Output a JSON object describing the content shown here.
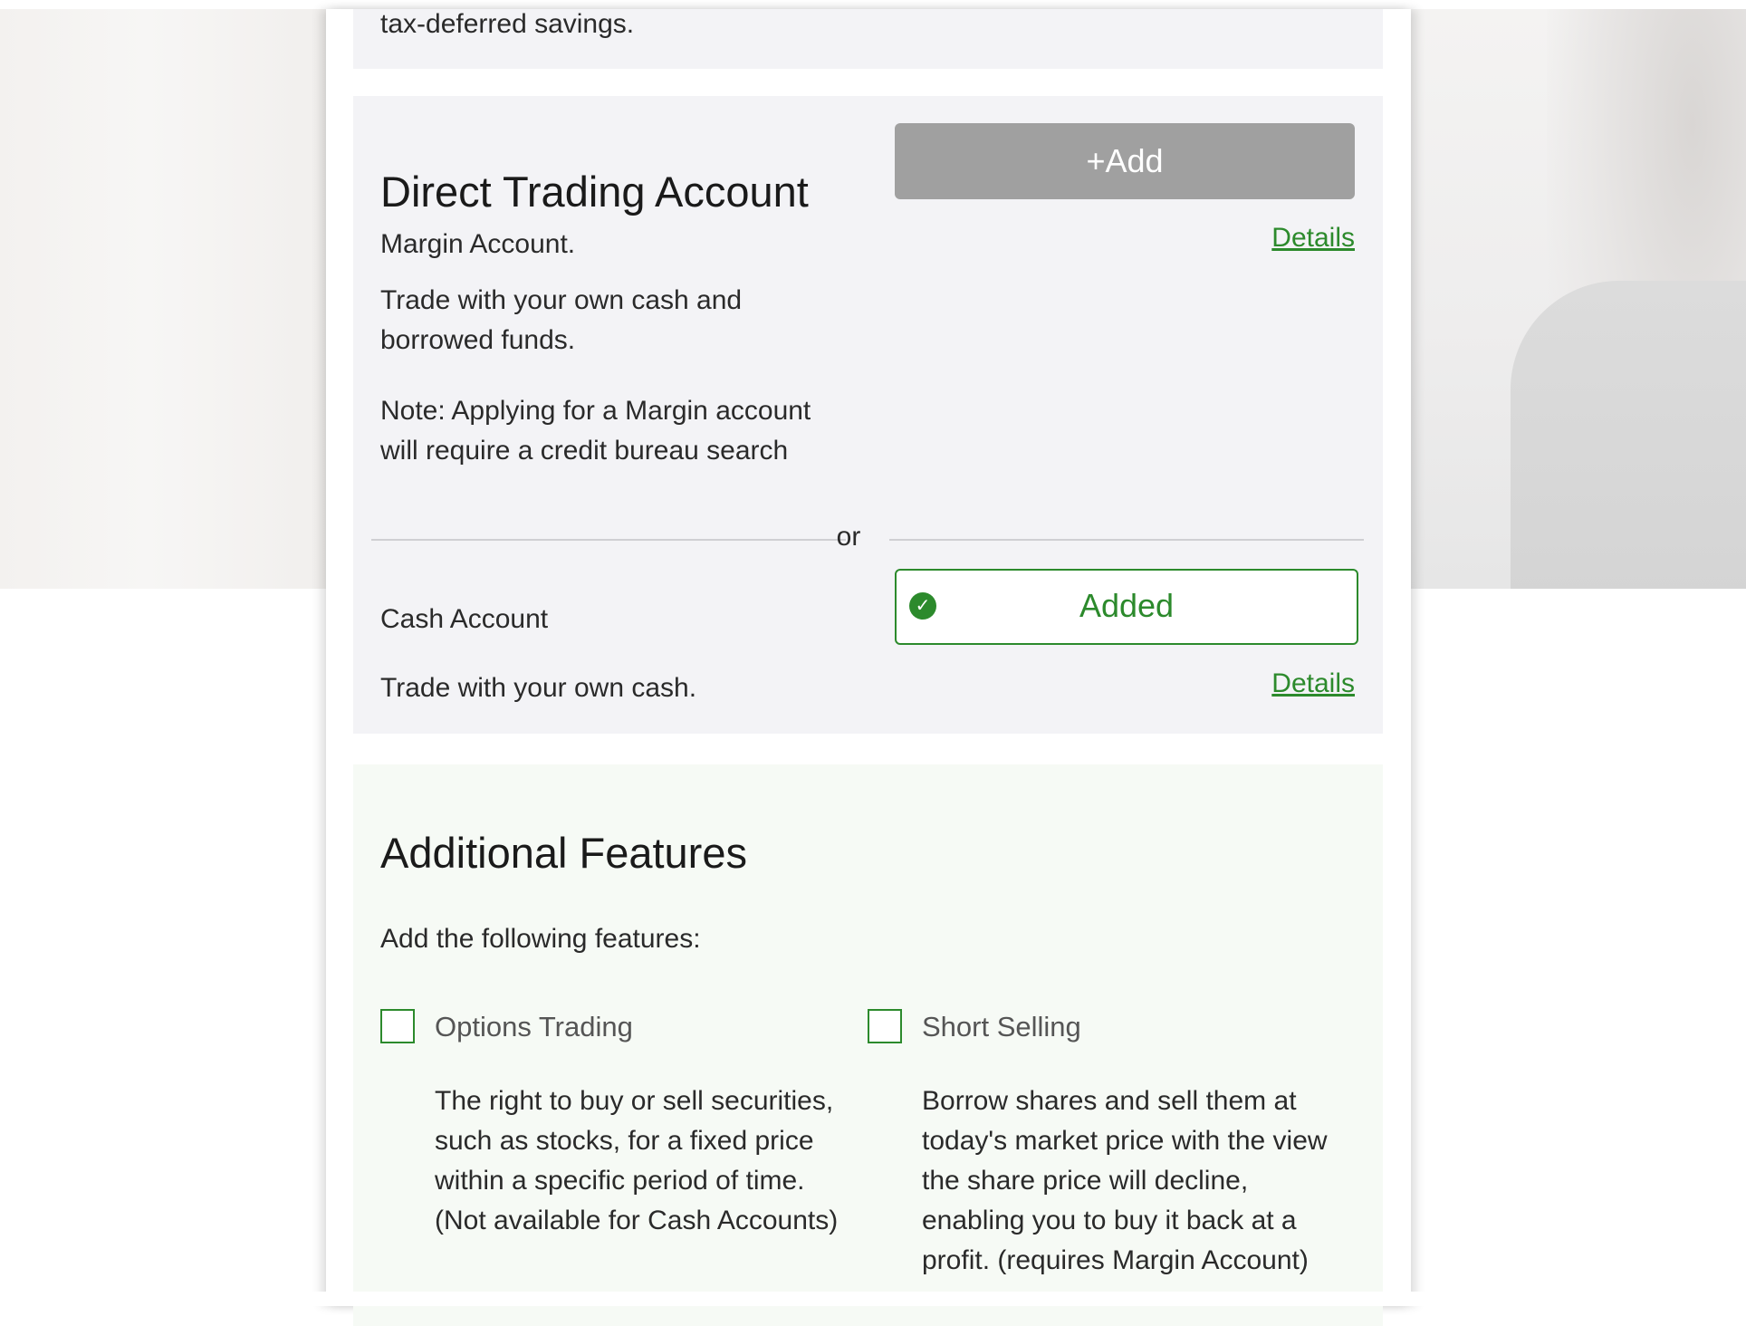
{
  "previous_card": {
    "text": "tax-deferred savings."
  },
  "direct_trading": {
    "title": "Direct Trading Account",
    "add_label": "+Add",
    "margin_details_label": "Details",
    "margin_title": "Margin Account.",
    "margin_desc_line1": "Trade with your own cash and",
    "margin_desc_line2": "borrowed funds.",
    "margin_note_line1": "Note: Applying for a Margin account",
    "margin_note_line2": "will require a credit bureau search",
    "or_label": "or",
    "cash_title": "Cash Account",
    "added_label": "Added",
    "cash_desc": "Trade with your own cash.",
    "cash_details_label": "Details"
  },
  "additional_features": {
    "title": "Additional Features",
    "intro": "Add the following features:",
    "options": {
      "label": "Options Trading",
      "checked": false,
      "desc": [
        "The right to buy or sell securities,",
        "such as stocks, for a fixed price",
        "within a specific period of time.",
        "(Not available for Cash Accounts)"
      ]
    },
    "short_selling": {
      "label": "Short Selling",
      "checked": false,
      "desc": [
        "Borrow shares and sell them at",
        "today's market price with the view",
        "the share price will decline,",
        "enabling you to buy it back at a",
        "profit. (requires Margin Account)"
      ]
    }
  },
  "colors": {
    "accent_green": "#2c8a2c",
    "disabled_button": "#a0a0a0",
    "card_background": "#f3f3f6",
    "features_background": "#f6faf5"
  },
  "icons": {
    "added": "check-circle-icon"
  }
}
